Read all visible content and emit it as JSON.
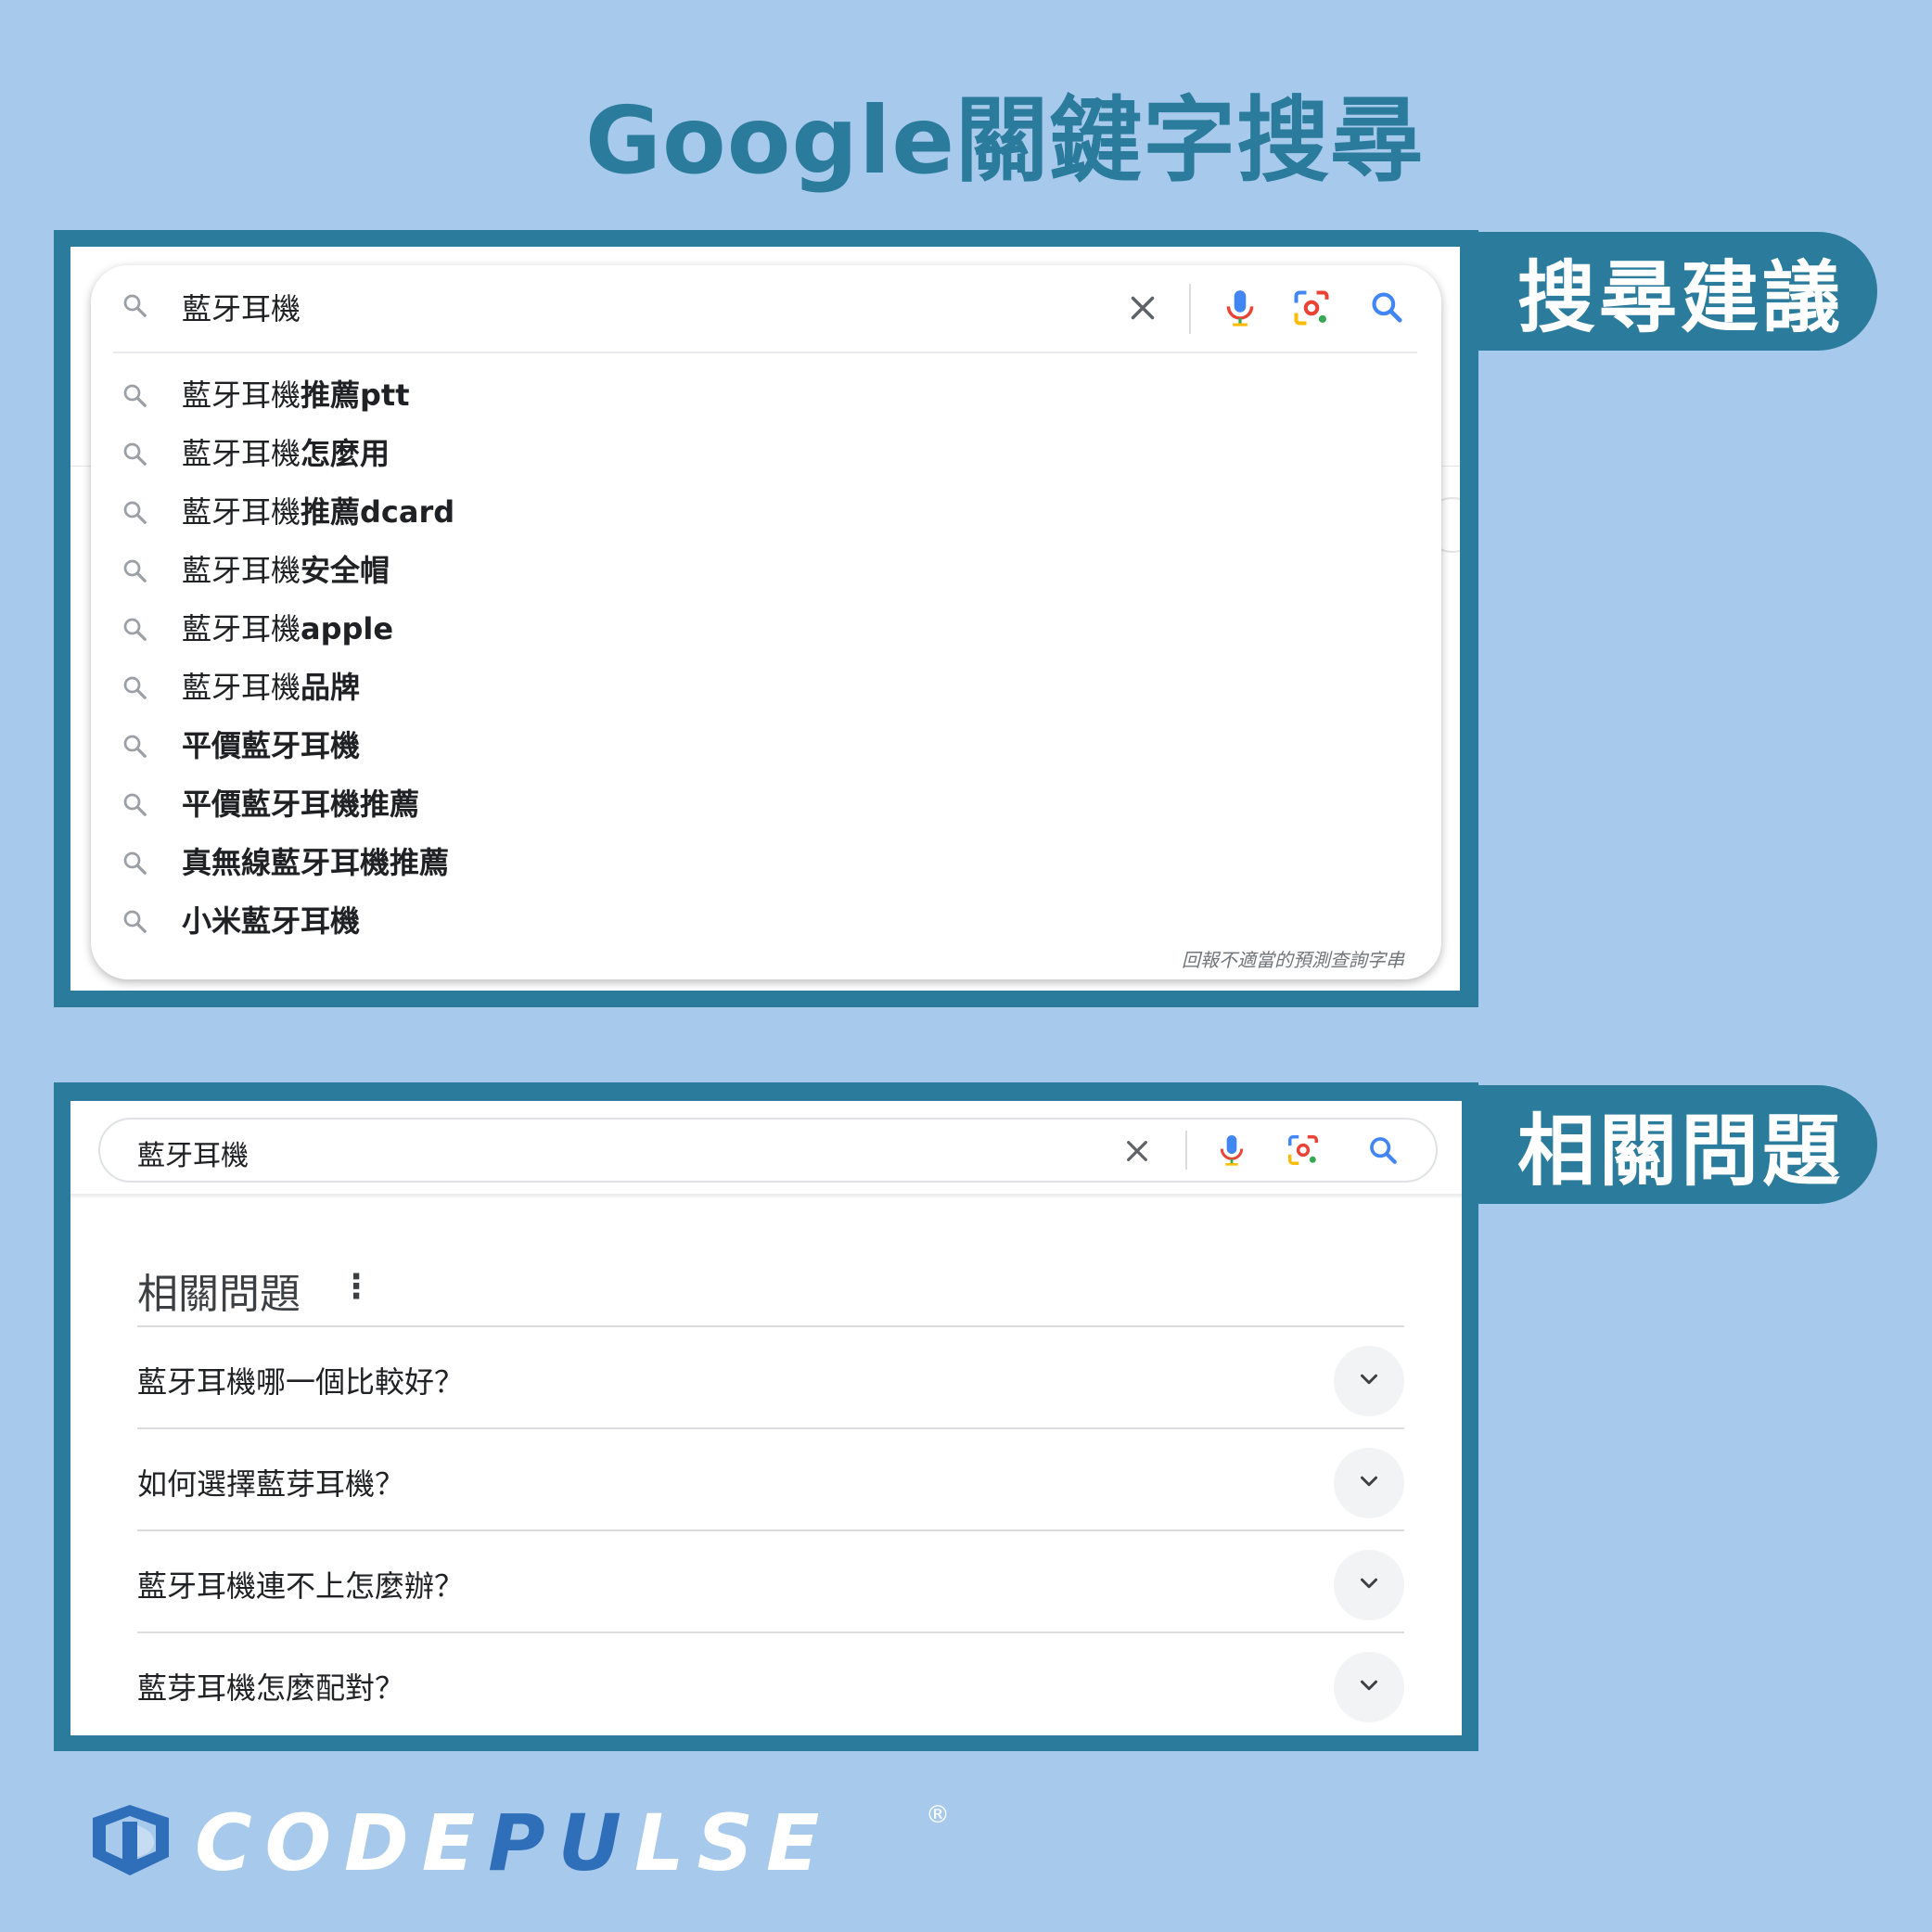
{
  "title": "Google關鍵字搜尋",
  "labels": {
    "suggestions": "搜尋建議",
    "related": "相關問題"
  },
  "search_box": {
    "query": "藍牙耳機",
    "icons": [
      "search-icon",
      "clear-icon",
      "mic-icon",
      "lens-icon",
      "search-submit-icon"
    ]
  },
  "suggestions": [
    {
      "prefix": "藍牙耳機",
      "bold": "推薦ptt"
    },
    {
      "prefix": "藍牙耳機",
      "bold": "怎麼用"
    },
    {
      "prefix": "藍牙耳機",
      "bold": "推薦dcard"
    },
    {
      "prefix": "藍牙耳機",
      "bold": "安全帽"
    },
    {
      "prefix": "藍牙耳機",
      "bold": "apple"
    },
    {
      "prefix": "藍牙耳機",
      "bold": "品牌"
    },
    {
      "prefix": "",
      "bold": "平價藍牙耳機"
    },
    {
      "prefix": "",
      "bold": "平價藍牙耳機推薦"
    },
    {
      "prefix": "",
      "bold": "真無線藍牙耳機推薦"
    },
    {
      "prefix": "",
      "bold": "小米藍牙耳機"
    }
  ],
  "report_text": "回報不適當的預測查詢字串",
  "paa": {
    "title": "相關問題",
    "more": "⋮",
    "questions": [
      "藍牙耳機哪一個比較好？",
      "如何選擇藍芽耳機？",
      "藍牙耳機連不上怎麼辦？",
      "藍芽耳機怎麼配對？"
    ]
  },
  "logo": {
    "text_a": "CODE",
    "text_b": "PU",
    "text_c": "LSE",
    "registered": "®"
  },
  "colors": {
    "background": "#a7c9eb",
    "frame": "#2b7b9c",
    "title": "#2b7b9c"
  }
}
